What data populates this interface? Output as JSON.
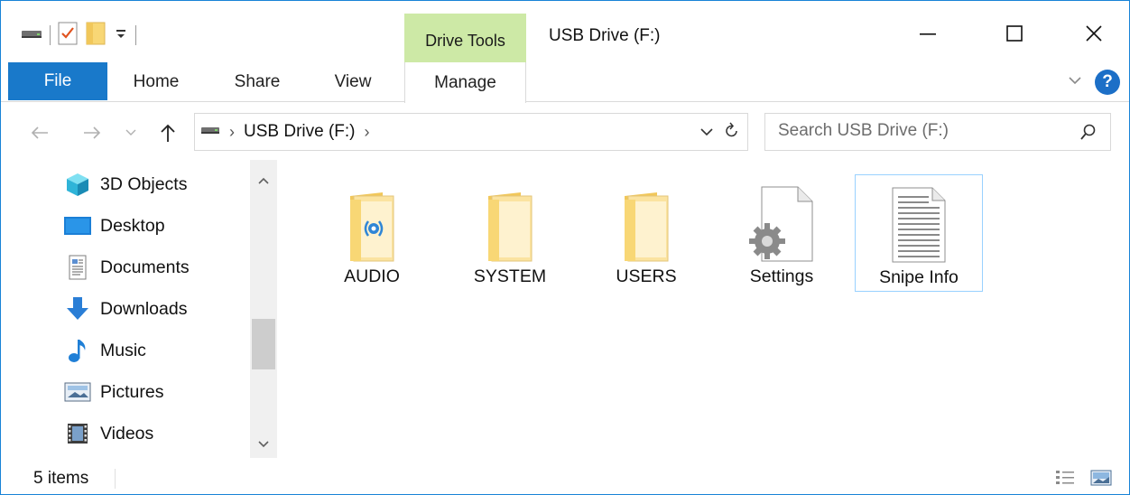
{
  "window": {
    "title": "USB Drive (F:)",
    "contextual_tab": "Drive Tools"
  },
  "ribbon": {
    "tabs": [
      "File",
      "Home",
      "Share",
      "View",
      "Manage"
    ]
  },
  "address": {
    "path_item": "USB Drive (F:)",
    "search_placeholder": "Search USB Drive (F:)"
  },
  "nav_pane": {
    "items": [
      {
        "label": "3D Objects",
        "icon": "3d-objects-icon"
      },
      {
        "label": "Desktop",
        "icon": "desktop-icon"
      },
      {
        "label": "Documents",
        "icon": "documents-icon"
      },
      {
        "label": "Downloads",
        "icon": "downloads-icon"
      },
      {
        "label": "Music",
        "icon": "music-icon"
      },
      {
        "label": "Pictures",
        "icon": "pictures-icon"
      },
      {
        "label": "Videos",
        "icon": "videos-icon"
      }
    ]
  },
  "files": [
    {
      "name": "AUDIO",
      "type": "folder",
      "icon": "audio-folder-icon"
    },
    {
      "name": "SYSTEM",
      "type": "folder",
      "icon": "folder-icon"
    },
    {
      "name": "USERS",
      "type": "folder",
      "icon": "folder-icon"
    },
    {
      "name": "Settings",
      "type": "file",
      "icon": "settings-file-icon"
    },
    {
      "name": "Snipe Info",
      "type": "file",
      "icon": "text-document-icon",
      "selected": true
    }
  ],
  "status": {
    "item_count": "5 items"
  },
  "colors": {
    "accent": "#1979ca",
    "drive_tools_tab": "#cde9a6",
    "selection_border": "#99d1ff",
    "folder_yellow": "#f8d775"
  }
}
